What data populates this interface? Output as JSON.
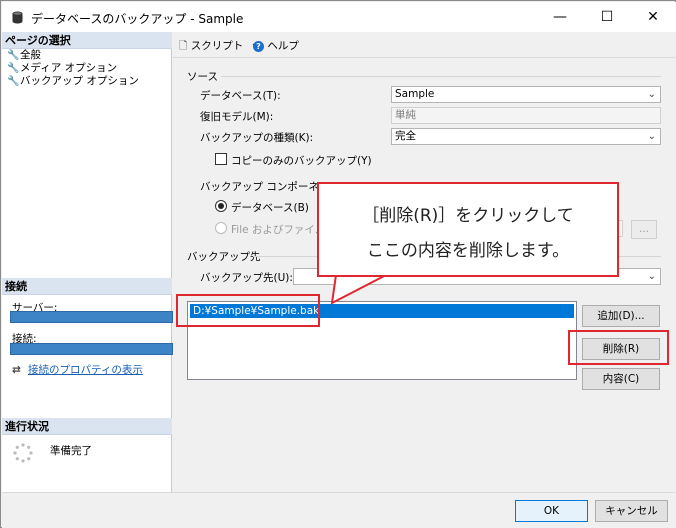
{
  "window": {
    "title": "データベースのバックアップ - Sample",
    "minimize": "—",
    "maximize": "☐",
    "close": "✕"
  },
  "left": {
    "select_page_header": "ページの選択",
    "pages": [
      "全般",
      "メディア オプション",
      "バックアップ オプション"
    ],
    "connection_header": "接続",
    "server_label": "サーバー:",
    "connection_label": "接続:",
    "connection_link": "接続のプロパティの表示",
    "progress_header": "進行状況",
    "progress_status": "準備完了"
  },
  "toolbar": {
    "script_label": "スクリプト",
    "help_label": "ヘルプ"
  },
  "source": {
    "group_title": "ソース",
    "database_label": "データベース(T):",
    "database_value": "Sample",
    "recovery_label": "復旧モデル(M):",
    "recovery_value": "単純",
    "backup_type_label": "バックアップの種類(K):",
    "backup_type_value": "完全",
    "copy_only_label": "コピーのみのバックアップ(Y)",
    "component_label": "バックアップ コンポーネント:",
    "component_database": "データベース(B)",
    "component_file": "File およびファイル グ"
  },
  "destination": {
    "group_title": "バックアップ先",
    "backup_to_label": "バックアップ先(U):",
    "backup_path": "D:¥Sample¥Sample.bak",
    "add_button": "追加(D)...",
    "remove_button": "削除(R)",
    "contents_button": "内容(C)"
  },
  "callout": {
    "line1": "［削除(R)］をクリックして",
    "line2": "ここの内容を削除します。"
  },
  "footer": {
    "ok_button": "OK",
    "cancel_button": "キャンセル"
  },
  "colors": {
    "highlight": "#e0262f",
    "selection": "#0078d7"
  }
}
